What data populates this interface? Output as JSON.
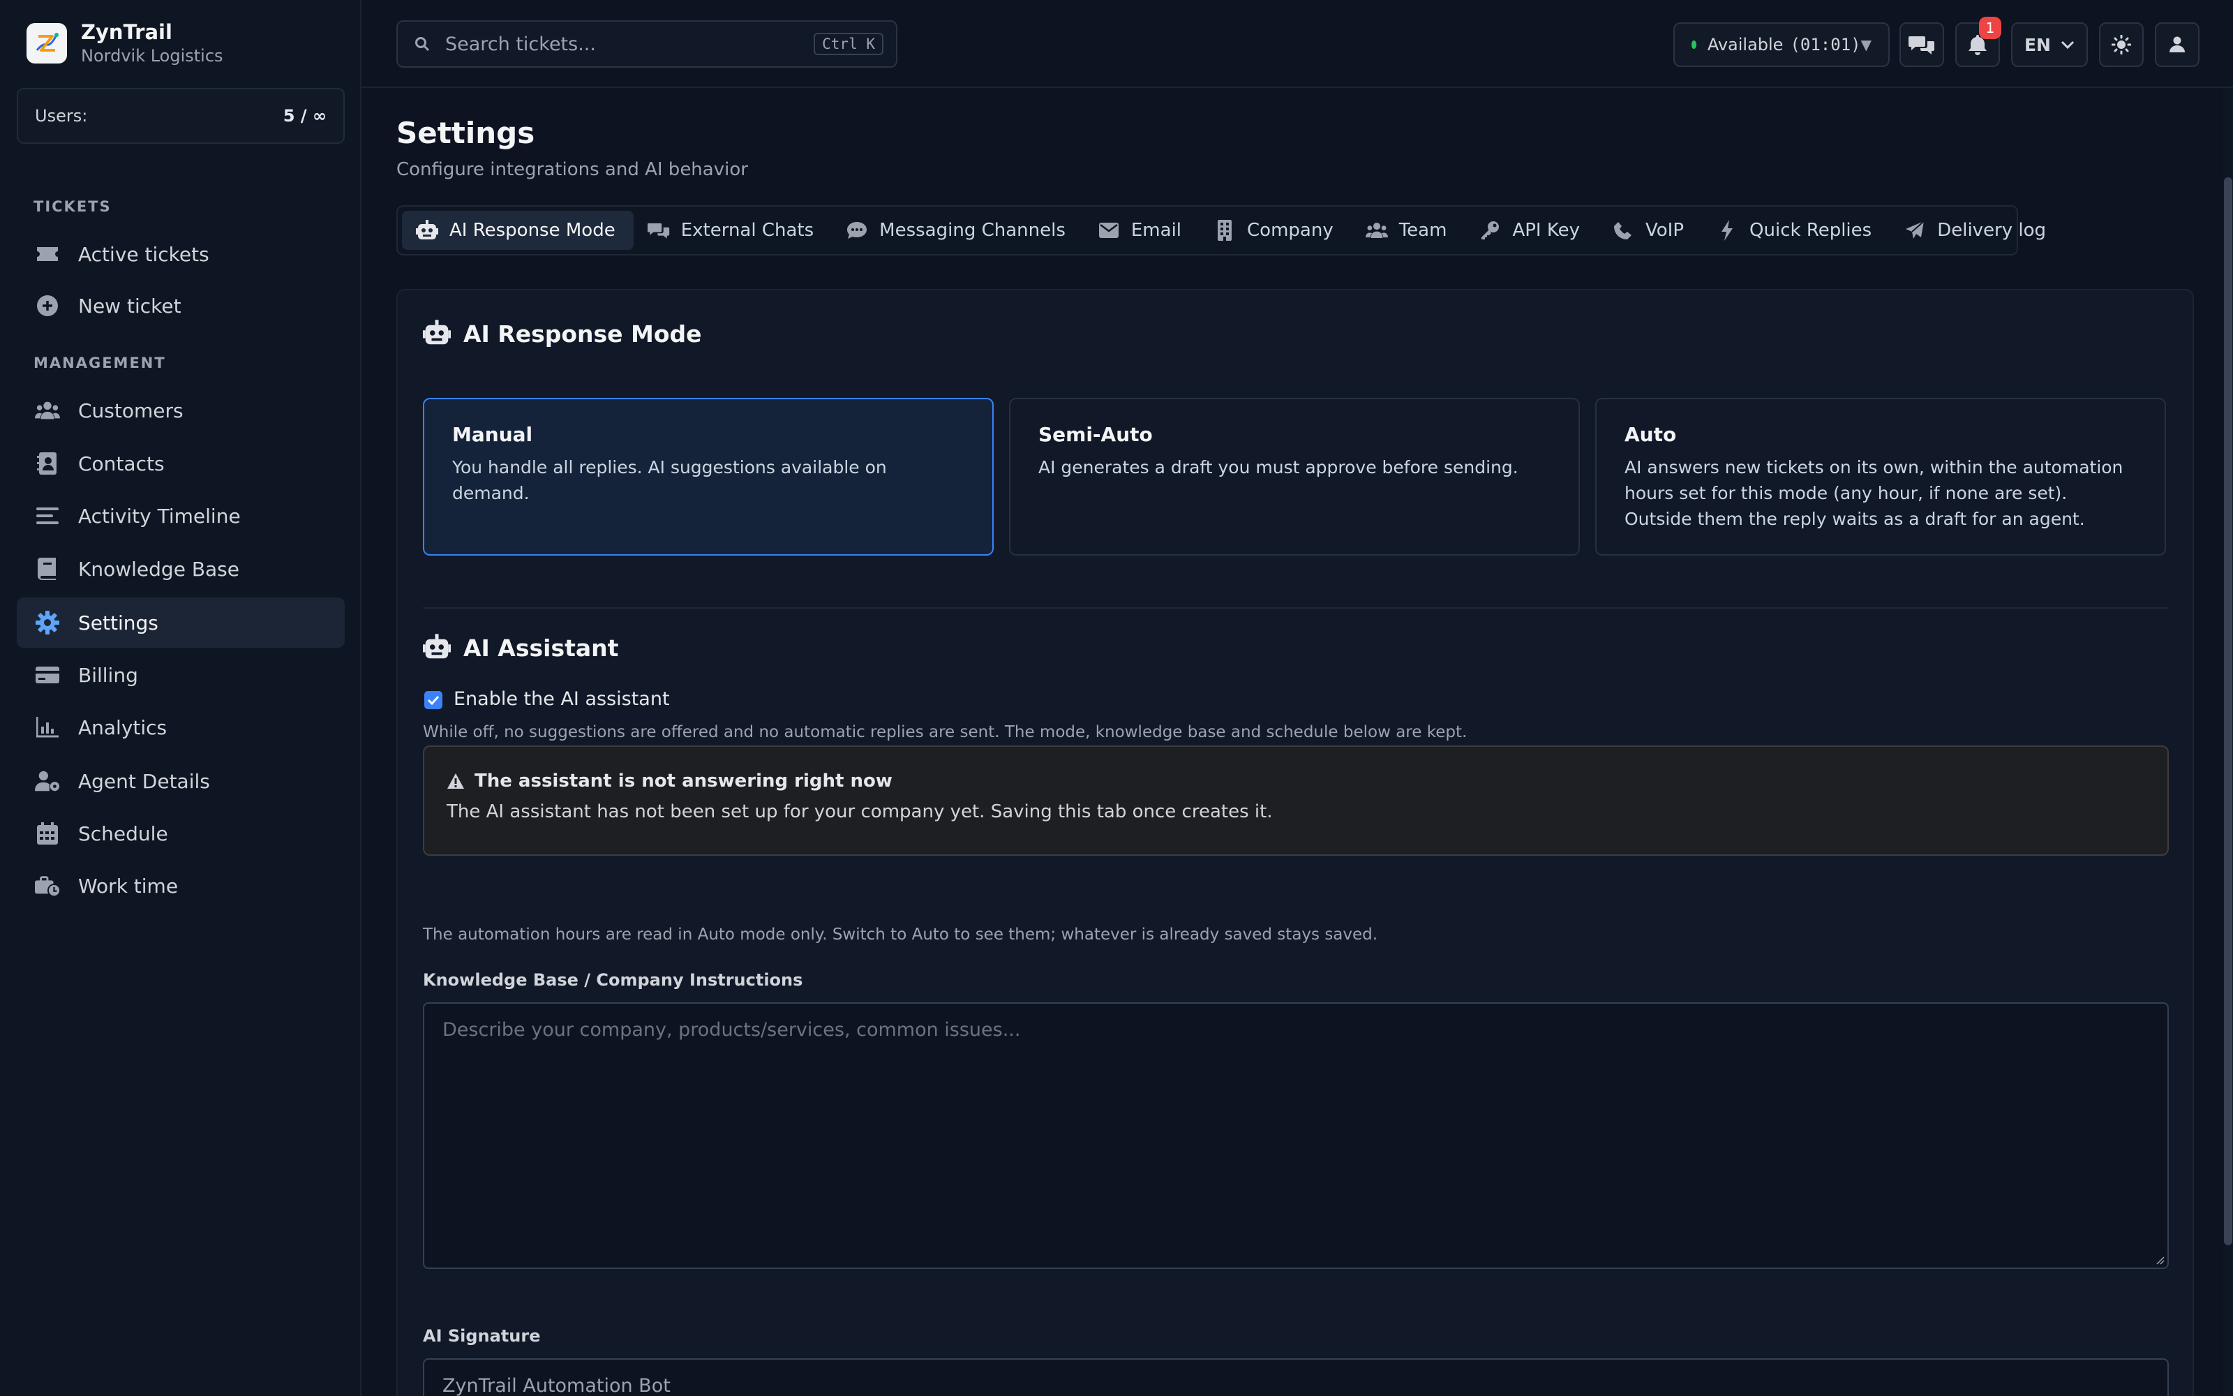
{
  "brand": {
    "name": "ZynTrail",
    "company": "Nordvik Logistics"
  },
  "users": {
    "label": "Users:",
    "value": "5 / ∞"
  },
  "sidebar": {
    "tickets_heading": "TICKETS",
    "tickets": [
      {
        "label": "Active tickets",
        "icon": "ticket-icon"
      },
      {
        "label": "New ticket",
        "icon": "plus-circle-icon"
      }
    ],
    "management_heading": "MANAGEMENT",
    "management": [
      {
        "label": "Customers",
        "icon": "users-icon"
      },
      {
        "label": "Contacts",
        "icon": "contact-book-icon"
      },
      {
        "label": "Activity Timeline",
        "icon": "timeline-icon"
      },
      {
        "label": "Knowledge Base",
        "icon": "book-icon"
      },
      {
        "label": "Settings",
        "icon": "gear-icon",
        "active": true
      },
      {
        "label": "Billing",
        "icon": "credit-card-icon"
      },
      {
        "label": "Analytics",
        "icon": "chart-icon"
      },
      {
        "label": "Agent Details",
        "icon": "user-gear-icon"
      },
      {
        "label": "Schedule",
        "icon": "calendar-icon"
      },
      {
        "label": "Work time",
        "icon": "briefcase-clock-icon"
      }
    ]
  },
  "header": {
    "search_placeholder": "Search tickets...",
    "search_shortcut": "Ctrl K",
    "status": {
      "label": "Available",
      "timer": "(01:01)"
    },
    "notifications_count": "1",
    "language": "EN"
  },
  "page": {
    "title": "Settings",
    "subtitle": "Configure integrations and AI behavior"
  },
  "tabs": [
    {
      "label": "AI Response Mode",
      "icon": "robot-icon",
      "active": true
    },
    {
      "label": "External Chats",
      "icon": "chats-icon"
    },
    {
      "label": "Messaging Channels",
      "icon": "message-icon"
    },
    {
      "label": "Email",
      "icon": "envelope-icon"
    },
    {
      "label": "Company",
      "icon": "building-icon"
    },
    {
      "label": "Team",
      "icon": "team-icon"
    },
    {
      "label": "API Key",
      "icon": "key-icon"
    },
    {
      "label": "VoIP",
      "icon": "phone-icon"
    },
    {
      "label": "Quick Replies",
      "icon": "bolt-icon"
    },
    {
      "label": "Delivery log",
      "icon": "paper-plane-icon"
    }
  ],
  "response_mode": {
    "heading": "AI Response Mode",
    "modes": [
      {
        "title": "Manual",
        "desc": "You handle all replies. AI suggestions available on demand.",
        "selected": true
      },
      {
        "title": "Semi-Auto",
        "desc": "AI generates a draft you must approve before sending."
      },
      {
        "title": "Auto",
        "desc": "AI answers new tickets on its own, within the automation hours set for this mode (any hour, if none are set). Outside them the reply waits as a draft for an agent."
      }
    ]
  },
  "assistant": {
    "heading": "AI Assistant",
    "enable_label": "Enable the AI assistant",
    "enabled": true,
    "enable_hint": "While off, no suggestions are offered and no automatic replies are sent. The mode, knowledge base and schedule below are kept.",
    "warning_title": "The assistant is not answering right now",
    "warning_text": "The AI assistant has not been set up for your company yet. Saving this tab once creates it.",
    "automation_hint": "The automation hours are read in Auto mode only. Switch to Auto to see them; whatever is already saved stays saved.",
    "kb_label": "Knowledge Base / Company Instructions",
    "kb_placeholder": "Describe your company, products/services, common issues...",
    "signature_label": "AI Signature",
    "signature_value": "ZynTrail Automation Bot"
  },
  "colors": {
    "accent": "#3b82f6",
    "status_online": "#22c55e",
    "badge": "#ef4444"
  }
}
